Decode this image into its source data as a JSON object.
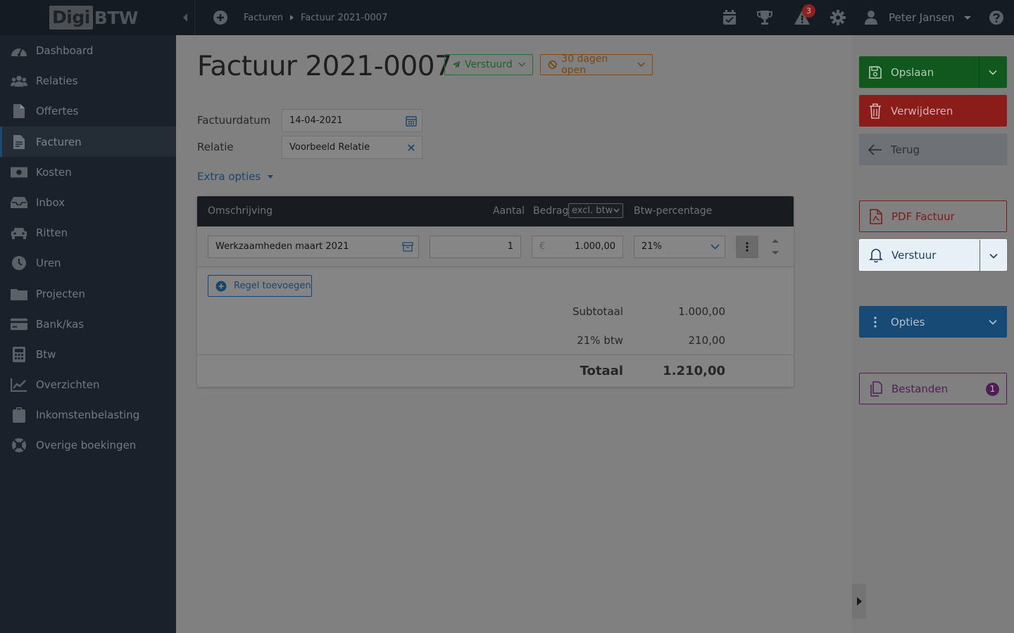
{
  "brand": {
    "part1": "Digi",
    "part2": "BTW"
  },
  "topbar": {
    "breadcrumbs": [
      "Facturen",
      "Factuur 2021-0007"
    ],
    "alert_count": "3",
    "user_name": "Peter Jansen"
  },
  "sidebar": {
    "items": [
      {
        "label": "Dashboard",
        "icon": "dashboard-icon"
      },
      {
        "label": "Relaties",
        "icon": "users-icon"
      },
      {
        "label": "Offertes",
        "icon": "file-icon"
      },
      {
        "label": "Facturen",
        "icon": "invoice-icon",
        "active": true
      },
      {
        "label": "Kosten",
        "icon": "money-icon"
      },
      {
        "label": "Inbox",
        "icon": "inbox-icon"
      },
      {
        "label": "Ritten",
        "icon": "car-icon"
      },
      {
        "label": "Uren",
        "icon": "clock-icon"
      },
      {
        "label": "Projecten",
        "icon": "folder-icon"
      },
      {
        "label": "Bank/kas",
        "icon": "credit-card-icon"
      },
      {
        "label": "Btw",
        "icon": "calculator-icon"
      },
      {
        "label": "Overzichten",
        "icon": "chart-icon"
      },
      {
        "label": "Inkomstenbelasting",
        "icon": "clipboard-icon"
      },
      {
        "label": "Overige boekingen",
        "icon": "lifebuoy-icon"
      }
    ]
  },
  "invoice": {
    "title": "Factuur 2021-0007",
    "status_sent": "Verstuurd",
    "status_open": "30 dagen open",
    "date_label": "Factuurdatum",
    "date_value": "14-04-2021",
    "relation_label": "Relatie",
    "relation_value": "Voorbeeld Relatie",
    "extra_options": "Extra opties"
  },
  "table": {
    "headers": {
      "description": "Omschrijving",
      "quantity": "Aantal",
      "amount": "Bedrag",
      "amount_mode": "excl. btw",
      "vat": "Btw-percentage"
    },
    "rows": [
      {
        "description": "Werkzaamheden maart 2021",
        "quantity": "1",
        "currency": "€",
        "amount": "1.000,00",
        "vat": "21%"
      }
    ],
    "add_row": "Regel toevoegen",
    "subtotal_label": "Subtotaal",
    "subtotal_value": "1.000,00",
    "vat_label": "21% btw",
    "vat_value": "210,00",
    "total_label": "Totaal",
    "total_value": "1.210,00"
  },
  "actions": {
    "save": "Opslaan",
    "delete": "Verwijderen",
    "back": "Terug",
    "pdf": "PDF Factuur",
    "send": "Verstuur",
    "options": "Opties",
    "files": "Bestanden",
    "files_count": "1"
  }
}
